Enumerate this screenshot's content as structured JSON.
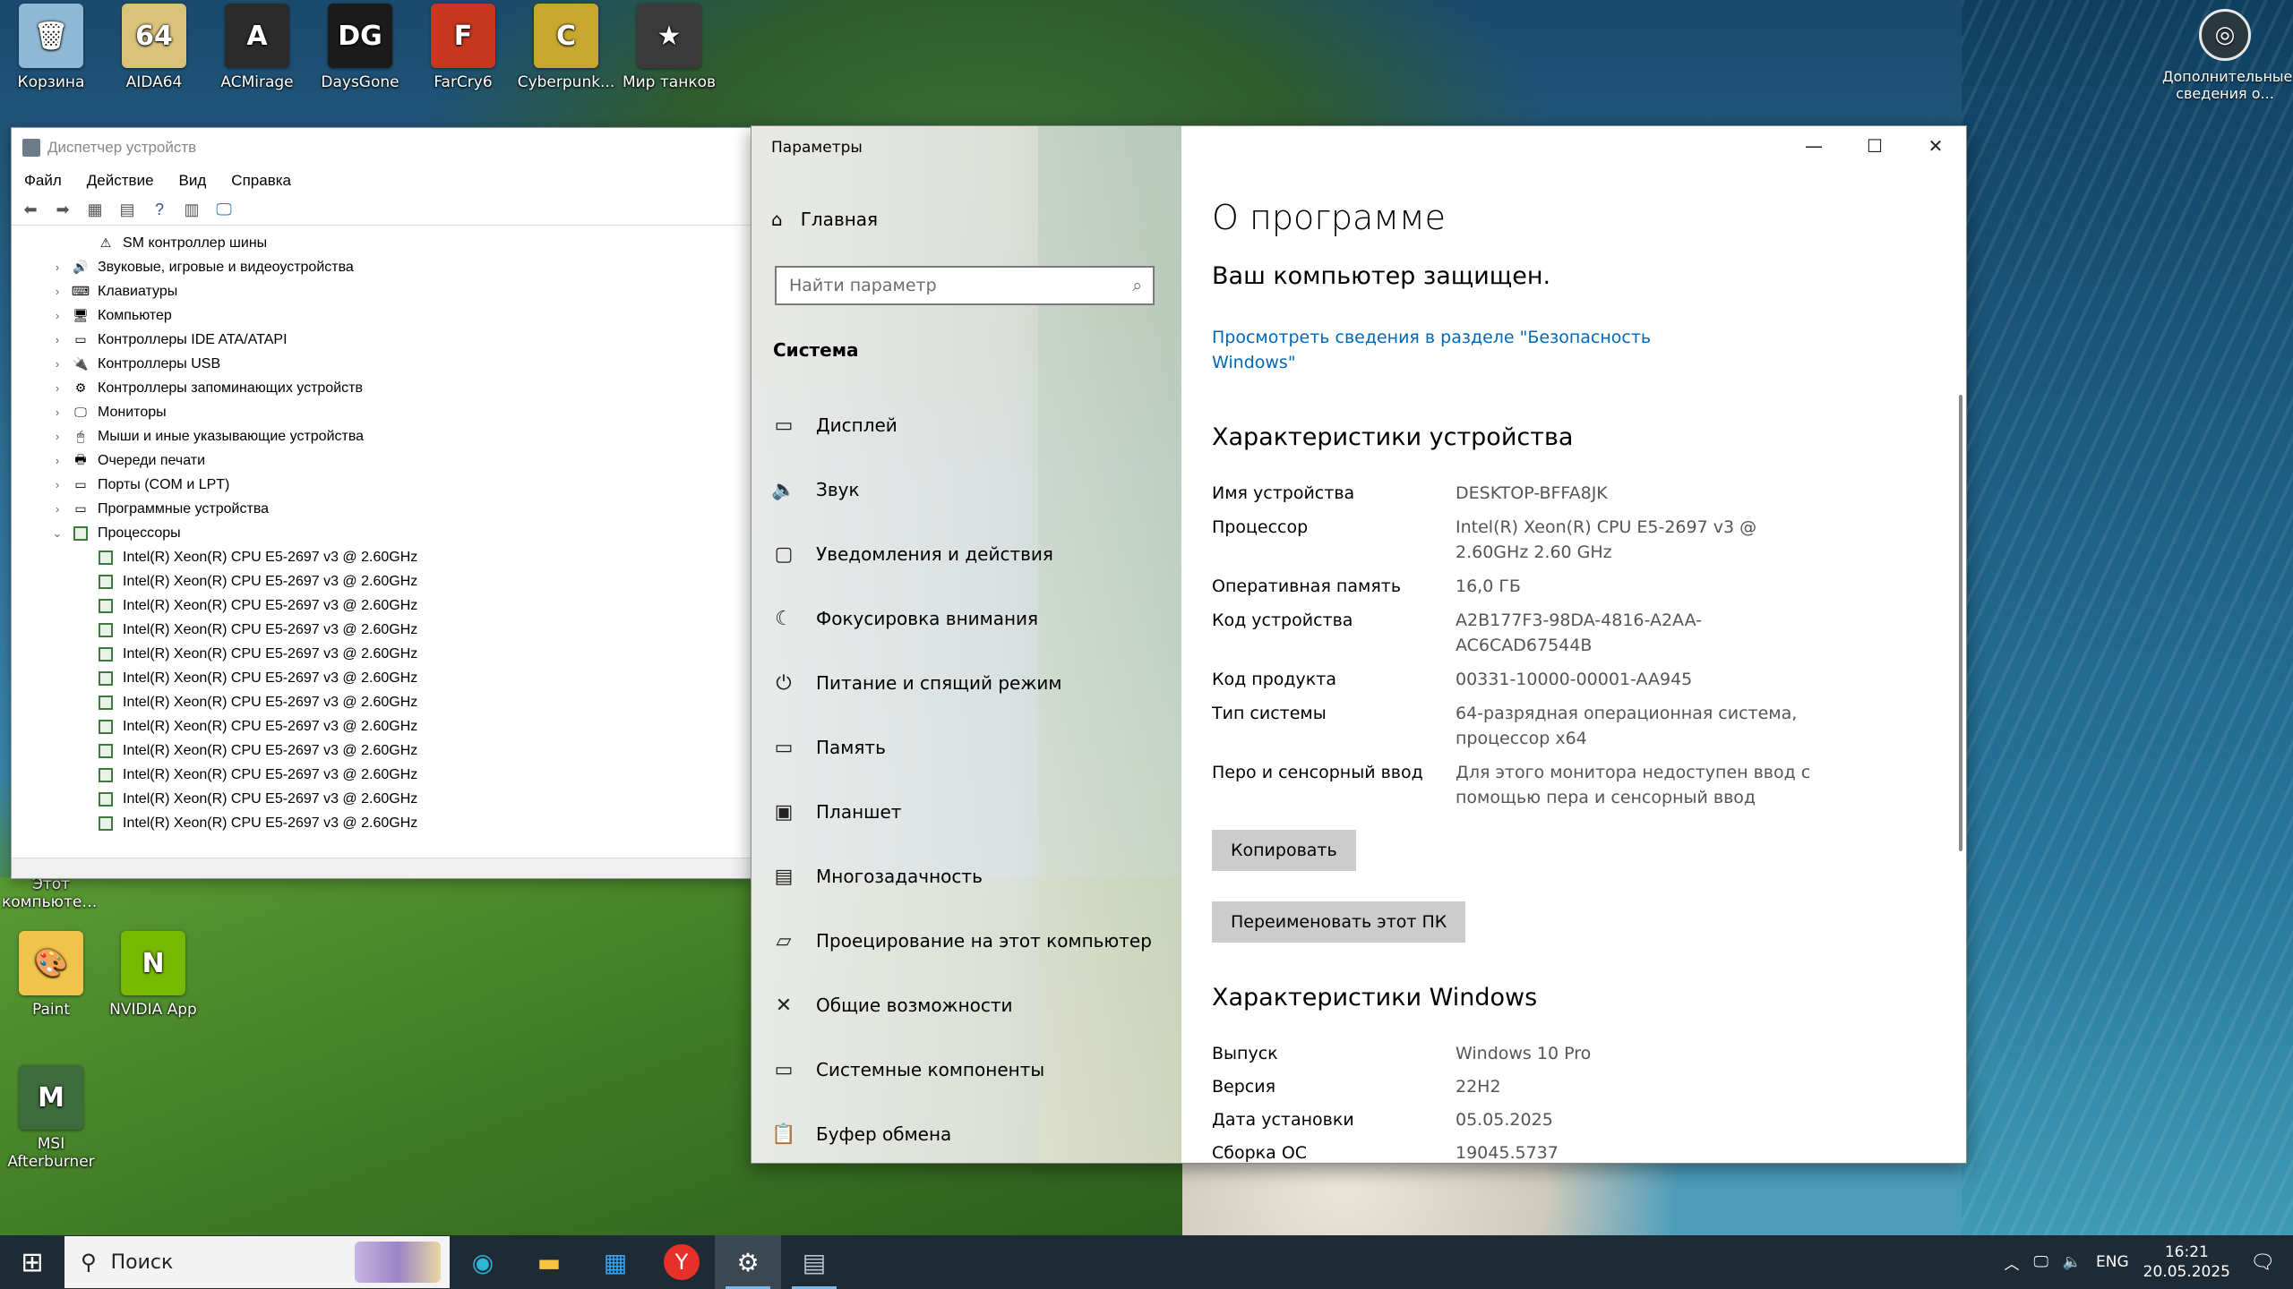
{
  "desktop": {
    "icons_top": [
      {
        "label": "Корзина",
        "color": "#8fb7d6",
        "glyph": "🗑"
      },
      {
        "label": "AIDA64",
        "color": "#d9c27a",
        "glyph": "64"
      },
      {
        "label": "ACMirage",
        "color": "#2b2b2b",
        "glyph": "A"
      },
      {
        "label": "DaysGone",
        "color": "#1b1b1b",
        "glyph": "DG"
      },
      {
        "label": "FarCry6",
        "color": "#c7361e",
        "glyph": "F"
      },
      {
        "label": "Cyberpunk...",
        "color": "#c9a830",
        "glyph": "C"
      },
      {
        "label": "Мир танков",
        "color": "#3a3a3a",
        "glyph": "★"
      }
    ],
    "icons_left": [
      {
        "label": "Этот компьютер...",
        "color": "#4a90c8",
        "glyph": "🖥"
      },
      {
        "label": "Paint",
        "color": "#f0c34a",
        "glyph": "🎨"
      },
      {
        "label": "NVIDIA App",
        "color": "#76b900",
        "glyph": "N"
      },
      {
        "label": "MSI Afterburner",
        "color": "#3d6b3d",
        "glyph": "M"
      }
    ],
    "widget_label": "Дополнительные сведения о..."
  },
  "device_manager": {
    "title": "Диспетчер устройств",
    "menu": [
      "Файл",
      "Действие",
      "Вид",
      "Справка"
    ],
    "tree": [
      {
        "label": "SM контроллер шины",
        "child": true,
        "icon": "⚠"
      },
      {
        "label": "Звуковые, игровые и видеоустройства",
        "child": false,
        "icon": "🔊"
      },
      {
        "label": "Клавиатуры",
        "child": false,
        "icon": "⌨"
      },
      {
        "label": "Компьютер",
        "child": false,
        "icon": "🖥"
      },
      {
        "label": "Контроллеры IDE ATA/ATAPI",
        "child": false,
        "icon": "▭"
      },
      {
        "label": "Контроллеры USB",
        "child": false,
        "icon": "🔌"
      },
      {
        "label": "Контроллеры запоминающих устройств",
        "child": false,
        "icon": "⚙"
      },
      {
        "label": "Мониторы",
        "child": false,
        "icon": "🖵"
      },
      {
        "label": "Мыши и иные указывающие устройства",
        "child": false,
        "icon": "🖱"
      },
      {
        "label": "Очереди печати",
        "child": false,
        "icon": "🖶"
      },
      {
        "label": "Порты (COM и LPT)",
        "child": false,
        "icon": "▭"
      },
      {
        "label": "Программные устройства",
        "child": false,
        "icon": "▭"
      },
      {
        "label": "Процессоры",
        "child": false,
        "expanded": true,
        "icon": "cpu"
      }
    ],
    "cpu_label": "Intel(R) Xeon(R) CPU E5-2697 v3 @ 2.60GHz",
    "cpu_count": 12
  },
  "settings": {
    "window_title": "Параметры",
    "home_label": "Главная",
    "search_placeholder": "Найти параметр",
    "system_header": "Система",
    "nav_items": [
      {
        "label": "Дисплей",
        "icon": "▭"
      },
      {
        "label": "Звук",
        "icon": "🔈"
      },
      {
        "label": "Уведомления и действия",
        "icon": "▢"
      },
      {
        "label": "Фокусировка внимания",
        "icon": "☾"
      },
      {
        "label": "Питание и спящий режим",
        "icon": "⏻"
      },
      {
        "label": "Память",
        "icon": "▭"
      },
      {
        "label": "Планшет",
        "icon": "▣"
      },
      {
        "label": "Многозадачность",
        "icon": "▤"
      },
      {
        "label": "Проецирование на этот компьютер",
        "icon": "▱"
      },
      {
        "label": "Общие возможности",
        "icon": "✕"
      },
      {
        "label": "Системные компоненты",
        "icon": "▭"
      },
      {
        "label": "Буфер обмена",
        "icon": "📋"
      }
    ],
    "page_title": "О программе",
    "protected_text": "Ваш компьютер защищен.",
    "security_link": "Просмотреть сведения в разделе \"Безопасность Windows\"",
    "device_section": "Характеристики устройства",
    "device_specs": [
      {
        "key": "Имя устройства",
        "value": "DESKTOP-BFFA8JK"
      },
      {
        "key": "Процессор",
        "value": "Intel(R) Xeon(R) CPU E5-2697 v3 @ 2.60GHz   2.60 GHz"
      },
      {
        "key": "Оперативная память",
        "value": "16,0 ГБ"
      },
      {
        "key": "Код устройства",
        "value": "A2B177F3-98DA-4816-A2AA-AC6CAD67544B"
      },
      {
        "key": "Код продукта",
        "value": "00331-10000-00001-AA945"
      },
      {
        "key": "Тип системы",
        "value": "64-разрядная операционная система, процессор x64"
      },
      {
        "key": "Перо и сенсорный ввод",
        "value": "Для этого монитора недоступен ввод с помощью пера и сенсорный ввод"
      }
    ],
    "copy_button": "Копировать",
    "rename_button": "Переименовать этот ПК",
    "windows_section": "Характеристики Windows",
    "windows_specs": [
      {
        "key": "Выпуск",
        "value": "Windows 10 Pro"
      },
      {
        "key": "Версия",
        "value": "22H2"
      },
      {
        "key": "Дата установки",
        "value": "05.05.2025"
      },
      {
        "key": "Сборка ОС",
        "value": "19045.5737"
      }
    ]
  },
  "taskbar": {
    "search_text": "Поиск",
    "lang": "ENG",
    "time": "16:21",
    "date": "20.05.2025"
  }
}
